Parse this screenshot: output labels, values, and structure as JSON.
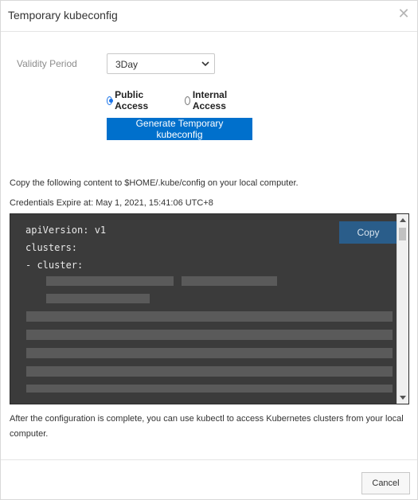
{
  "dialog": {
    "title": "Temporary kubeconfig",
    "close_icon": "close-icon"
  },
  "form": {
    "validity_label": "Validity Period",
    "validity_value": "3Day",
    "access_options": [
      {
        "label": "Public Access",
        "checked": true
      },
      {
        "label": "Internal Access",
        "checked": false
      }
    ],
    "generate_label": "Generate Temporary kubeconfig"
  },
  "info": {
    "copy_instruction": "Copy the following content to $HOME/.kube/config on your local computer.",
    "expire_text": "Credentials Expire at: May 1, 2021, 15:41:06 UTC+8"
  },
  "code": {
    "lines": [
      "apiVersion: v1",
      "clusters:",
      "- cluster:"
    ],
    "copy_label": "Copy"
  },
  "after_text": "After the configuration is complete, you can use kubectl to access Kubernetes clusters from your local computer.",
  "footer": {
    "cancel_label": "Cancel"
  }
}
